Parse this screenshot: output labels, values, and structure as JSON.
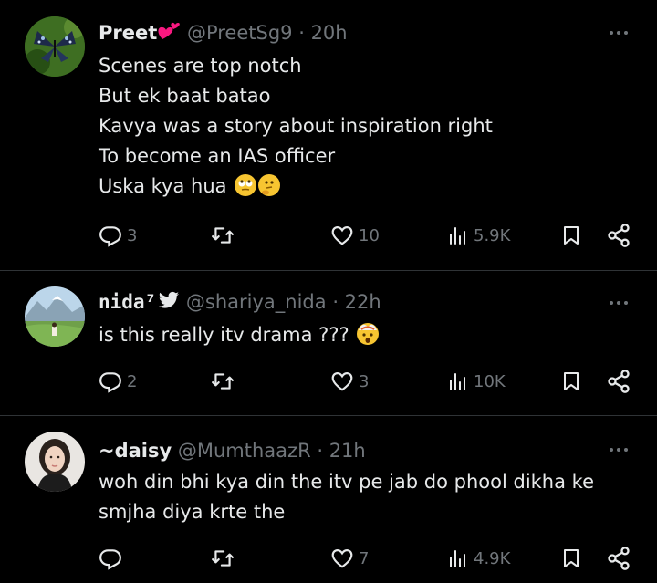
{
  "tweets": [
    {
      "name": "Preet",
      "handle": "@PreetSg9",
      "time": "20h",
      "lines": [
        "Scenes are top notch",
        "But ek baat batao",
        "Kavya was a story about inspiration right",
        "To become an IAS officer",
        "Uska kya hua"
      ],
      "emojis": [
        "eye-roll-emoji",
        "thinking-emoji"
      ],
      "replies": "3",
      "retweets": "",
      "likes": "10",
      "views": "5.9K"
    },
    {
      "name": "nida⁷",
      "handle": "@shariya_nida",
      "time": "22h",
      "lines": [
        "is this really itv drama ???"
      ],
      "emojis": [
        "exploding-head-emoji"
      ],
      "replies": "2",
      "retweets": "",
      "likes": "3",
      "views": "10K"
    },
    {
      "name": "~daisy",
      "handle": "@MumthaazR",
      "time": "21h",
      "lines": [
        "woh din bhi kya din the itv pe jab do phool dikha ke",
        "smjha diya krte the"
      ],
      "emojis": [],
      "replies": "",
      "retweets": "",
      "likes": "7",
      "views": "4.9K"
    }
  ],
  "separator": " · ",
  "colors": {
    "background": "#000000",
    "text": "#e7e9ea",
    "muted": "#71767b",
    "divider": "#2f3336",
    "heart": "#f91880"
  },
  "icons": [
    "reply-icon",
    "retweet-icon",
    "like-icon",
    "views-icon",
    "bookmark-icon",
    "share-icon",
    "more-icon",
    "heart-emoji-icon",
    "bird-icon"
  ]
}
